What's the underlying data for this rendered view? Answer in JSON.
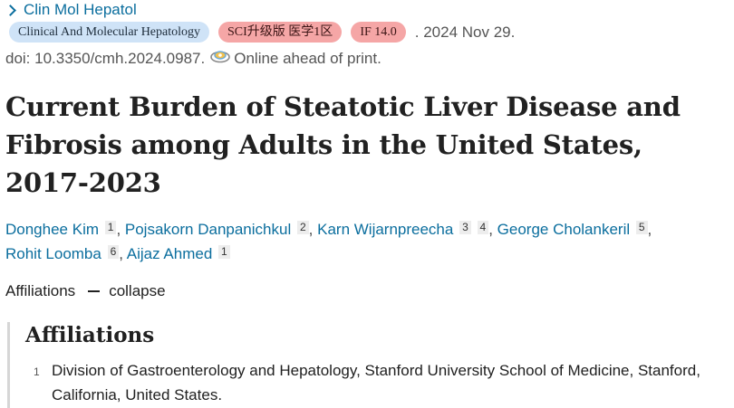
{
  "journal": {
    "name": "Clin Mol Hepatol"
  },
  "meta": {
    "journal_full_badge": "Clinical And Molecular Hepatology",
    "sci_badge": "SCI升级版 医学1区",
    "if_badge": "IF 14.0",
    "date": ". 2024 Nov 29."
  },
  "doi": {
    "text": "doi: 10.3350/cmh.2024.0987.",
    "status": "Online ahead of print."
  },
  "article": {
    "title": "Current Burden of Steatotic Liver Disease and Fibrosis among Adults in the United States, 2017-2023"
  },
  "authors": [
    {
      "name": "Donghee Kim",
      "affs": [
        "1"
      ]
    },
    {
      "name": "Pojsakorn Danpanichkul",
      "affs": [
        "2"
      ]
    },
    {
      "name": "Karn Wijarnpreecha",
      "affs": [
        "3",
        "4"
      ]
    },
    {
      "name": "George Cholankeril",
      "affs": [
        "5"
      ]
    },
    {
      "name": "Rohit Loomba",
      "affs": [
        "6"
      ]
    },
    {
      "name": "Aijaz Ahmed",
      "affs": [
        "1"
      ]
    }
  ],
  "affiliations_toggle": {
    "label": "Affiliations",
    "action": "collapse"
  },
  "affiliations": {
    "heading": "Affiliations",
    "items": [
      {
        "num": "1",
        "text": "Division of Gastroenterology and Hepatology, Stanford University School of Medicine, Stanford, California, United States."
      }
    ]
  }
}
